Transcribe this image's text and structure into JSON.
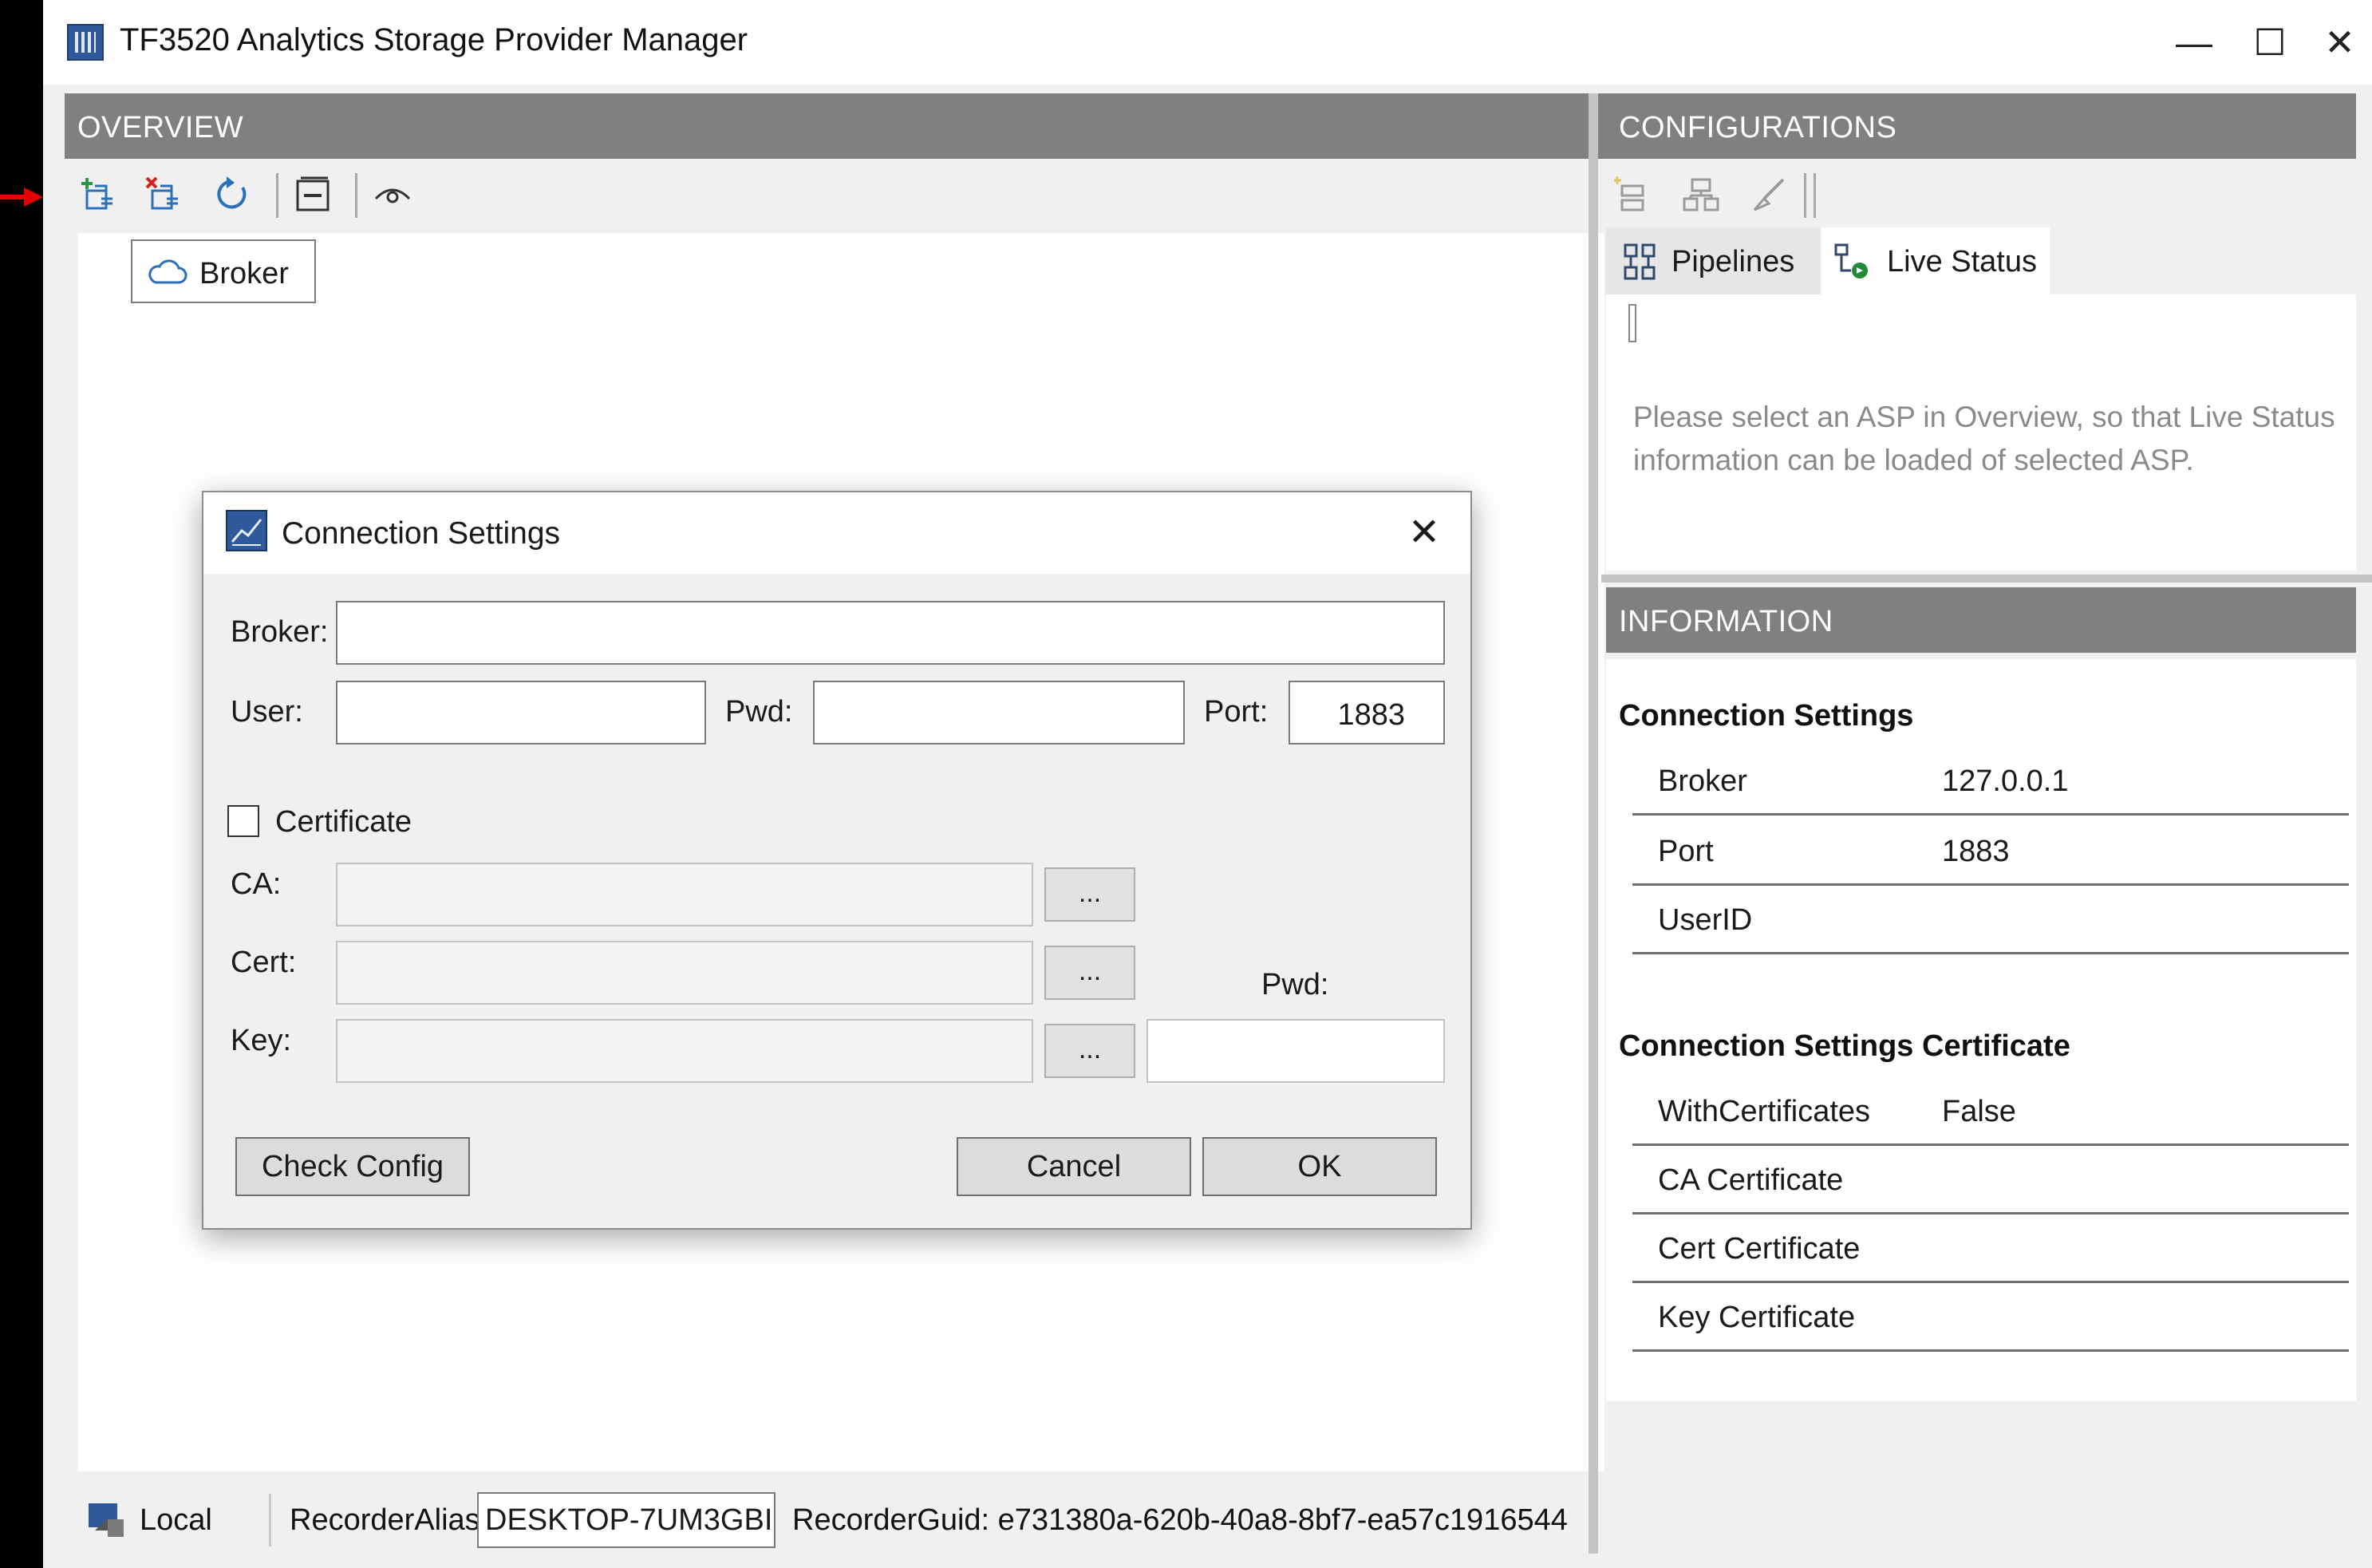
{
  "window": {
    "title": "TF3520 Analytics Storage Provider Manager",
    "minimize_glyph": "—",
    "maximize_glyph": "☐",
    "close_glyph": "✕"
  },
  "overview": {
    "header": "OVERVIEW",
    "toolbar_icons": [
      "add-broker-icon",
      "remove-broker-icon",
      "refresh-icon",
      "collapse-icon",
      "view-icon"
    ],
    "tree": [
      {
        "label": "Broker",
        "icon": "cloud-icon"
      }
    ]
  },
  "status_bar": {
    "mode": "Local",
    "recorder_alias_label": "RecorderAlias:",
    "recorder_alias_value": "DESKTOP-7UM3GBI",
    "recorder_guid": "RecorderGuid: e731380a-620b-40a8-8bf7-ea57c1916544"
  },
  "configurations": {
    "header": "CONFIGURATIONS",
    "tabs": [
      {
        "label": "Pipelines",
        "icon": "pipelines-icon"
      },
      {
        "label": "Live Status",
        "icon": "live-status-icon",
        "active": true
      }
    ],
    "live_status_message": "Please select an ASP in Overview, so that Live Status information can be loaded of selected ASP."
  },
  "information": {
    "header": "INFORMATION",
    "connection_settings": {
      "title": "Connection Settings",
      "rows": [
        {
          "key": "Broker",
          "value": "127.0.0.1"
        },
        {
          "key": "Port",
          "value": "1883"
        },
        {
          "key": "UserID",
          "value": ""
        }
      ]
    },
    "certificate_settings": {
      "title": "Connection Settings Certificate",
      "rows": [
        {
          "key": "WithCertificates",
          "value": "False"
        },
        {
          "key": "CA Certificate",
          "value": ""
        },
        {
          "key": "Cert Certificate",
          "value": ""
        },
        {
          "key": "Key Certificate",
          "value": ""
        }
      ]
    }
  },
  "dialog": {
    "title": "Connection Settings",
    "close_glyph": "✕",
    "broker_label": "Broker:",
    "broker_value": "",
    "user_label": "User:",
    "user_value": "",
    "pwd_label": "Pwd:",
    "pwd_value": "",
    "port_label": "Port:",
    "port_value": "1883",
    "certificate_label": "Certificate",
    "certificate_checked": false,
    "ca_label": "CA:",
    "cert_label": "Cert:",
    "key_label": "Key:",
    "key_pwd_label": "Pwd:",
    "browse_label": "...",
    "check_config_label": "Check Config",
    "cancel_label": "Cancel",
    "ok_label": "OK"
  },
  "colors": {
    "header_gray": "#808080",
    "accent_blue": "#2a70b8",
    "annotation_red": "#e60000",
    "live_green": "#1f8a3a"
  }
}
